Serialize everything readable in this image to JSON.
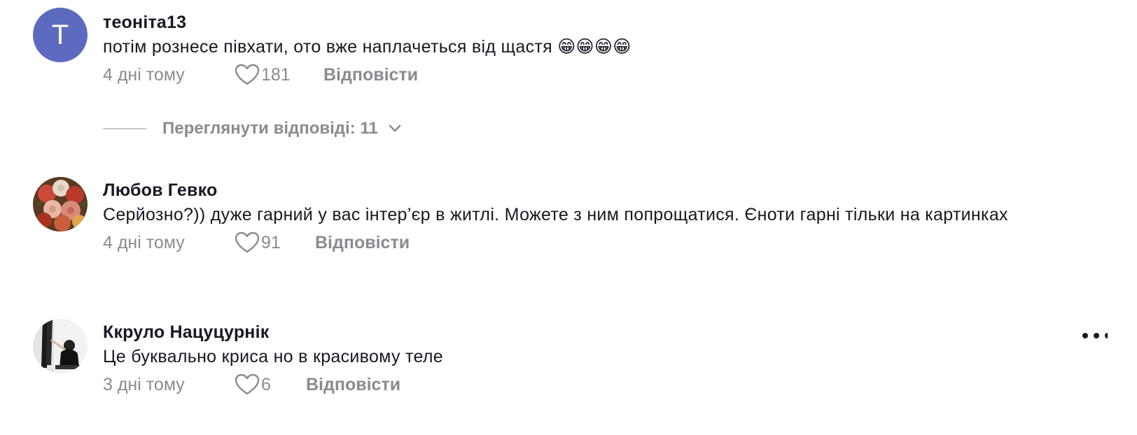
{
  "comments": [
    {
      "username": "теоніта13",
      "avatar_letter": "T",
      "text": "потім рознесе півхати, ото вже наплачеться від щастя 😁😁😁😁",
      "time": "4 дні тому",
      "likes": "181",
      "reply_label": "Відповісти"
    },
    {
      "username": "Любов Гевко",
      "text": "Серйозно?)) дуже гарний у вас інтер’єр в житлі. Можете з ним попрощатися. Єноти гарні тільки на картинках",
      "time": "4 дні тому",
      "likes": "91",
      "reply_label": "Відповісти"
    },
    {
      "username": "Ккруло Нацуцурнік",
      "text": "Це буквально криса но в красивому теле",
      "time": "3 дні тому",
      "likes": "6",
      "reply_label": "Відповісти"
    }
  ],
  "view_replies": {
    "label": "Переглянути відповіді: 11"
  },
  "colors": {
    "avatar_bg": "#5c6bc0",
    "muted_text": "#8a8b91",
    "primary_text": "#161823"
  },
  "icons": [
    "heart-icon",
    "chevron-down-icon",
    "more-options-icon"
  ]
}
